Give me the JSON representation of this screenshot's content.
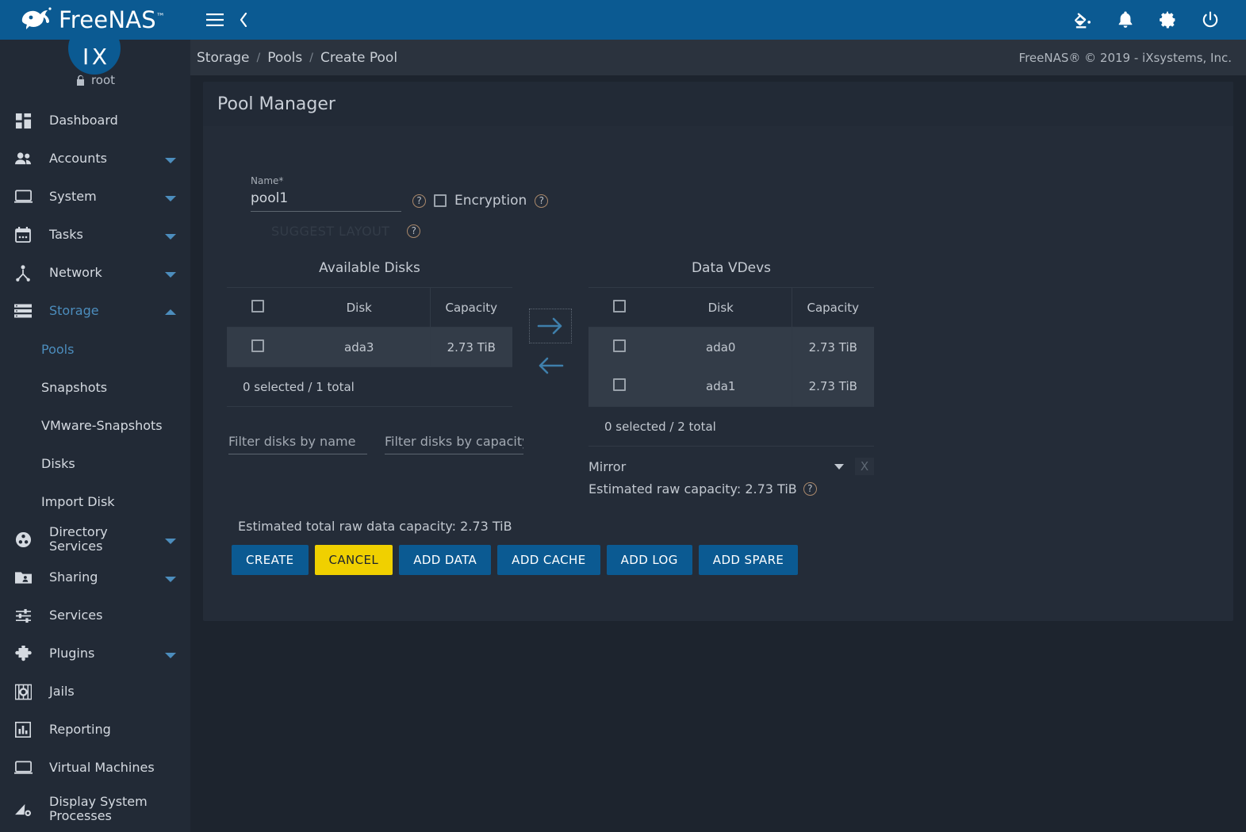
{
  "brand": {
    "name": "FreeNAS",
    "tm": "™",
    "avatar_text": "I X",
    "user": "root"
  },
  "sidebar": {
    "items": [
      {
        "label": "Dashboard",
        "icon": "dashboard-icon",
        "expandable": false,
        "active": false
      },
      {
        "label": "Accounts",
        "icon": "accounts-icon",
        "expandable": true,
        "active": false
      },
      {
        "label": "System",
        "icon": "system-icon",
        "expandable": true,
        "active": false
      },
      {
        "label": "Tasks",
        "icon": "tasks-icon",
        "expandable": true,
        "active": false
      },
      {
        "label": "Network",
        "icon": "network-icon",
        "expandable": true,
        "active": false
      },
      {
        "label": "Storage",
        "icon": "storage-icon",
        "expandable": true,
        "active": true
      }
    ],
    "storage_children": [
      {
        "label": "Pools",
        "active": true
      },
      {
        "label": "Snapshots",
        "active": false
      },
      {
        "label": "VMware-Snapshots",
        "active": false
      },
      {
        "label": "Disks",
        "active": false
      },
      {
        "label": "Import Disk",
        "active": false
      }
    ],
    "items_after": [
      {
        "label": "Directory Services",
        "icon": "directory-services-icon",
        "expandable": true
      },
      {
        "label": "Sharing",
        "icon": "sharing-icon",
        "expandable": true
      },
      {
        "label": "Services",
        "icon": "services-icon",
        "expandable": false
      },
      {
        "label": "Plugins",
        "icon": "plugins-icon",
        "expandable": true
      },
      {
        "label": "Jails",
        "icon": "jails-icon",
        "expandable": false
      },
      {
        "label": "Reporting",
        "icon": "reporting-icon",
        "expandable": false
      },
      {
        "label": "Virtual Machines",
        "icon": "virtual-machines-icon",
        "expandable": false
      },
      {
        "label": "Display System Processes",
        "icon": "display-system-processes-icon",
        "expandable": false
      }
    ]
  },
  "topbar": {
    "menu_icon": "hamburger-menu-icon",
    "back_icon": "chevron-left-icon",
    "right_icons": [
      {
        "name": "theme-icon"
      },
      {
        "name": "notifications-bell-icon"
      },
      {
        "name": "settings-gear-icon"
      },
      {
        "name": "power-icon"
      }
    ]
  },
  "breadcrumb": {
    "items": [
      "Storage",
      "Pools",
      "Create Pool"
    ],
    "separator": "/",
    "copyright": "FreeNAS® © 2019 - iXsystems, Inc."
  },
  "page": {
    "title": "Pool Manager",
    "name_field": {
      "label": "Name",
      "required_mark": "*",
      "value": "pool1"
    },
    "encryption": {
      "label": "Encryption",
      "checked": false
    },
    "suggest_layout_label": "SUGGEST LAYOUT",
    "help_glyph": "?"
  },
  "available_disks": {
    "title": "Available Disks",
    "columns": [
      "Disk",
      "Capacity"
    ],
    "rows": [
      {
        "disk": "ada3",
        "capacity": "2.73 TiB",
        "selected": false
      }
    ],
    "footer": "0 selected / 1 total",
    "filters": [
      {
        "placeholder": "Filter disks by name",
        "value": ""
      },
      {
        "placeholder": "Filter disks by capacity",
        "value": ""
      }
    ]
  },
  "data_vdevs": {
    "title": "Data VDevs",
    "columns": [
      "Disk",
      "Capacity"
    ],
    "rows": [
      {
        "disk": "ada0",
        "capacity": "2.73 TiB",
        "selected": false
      },
      {
        "disk": "ada1",
        "capacity": "2.73 TiB",
        "selected": false
      }
    ],
    "footer": "0 selected / 2 total",
    "vdev_type": "Mirror",
    "remove_label": "X",
    "raw_capacity": "Estimated raw capacity: 2.73 TiB"
  },
  "transfer": {
    "to_right_icon": "arrow-right-icon",
    "to_left_icon": "arrow-left-icon"
  },
  "footer": {
    "total_capacity": "Estimated total raw data capacity: 2.73 TiB",
    "buttons": [
      {
        "label": "CREATE",
        "style": "primary"
      },
      {
        "label": "CANCEL",
        "style": "warn"
      },
      {
        "label": "ADD DATA",
        "style": "primary"
      },
      {
        "label": "ADD CACHE",
        "style": "primary"
      },
      {
        "label": "ADD LOG",
        "style": "primary"
      },
      {
        "label": "ADD SPARE",
        "style": "primary"
      }
    ]
  },
  "colors": {
    "brand_blue": "#0b5a92",
    "accent_link": "#4c8dbd",
    "warn_yellow": "#f0d000",
    "sidebar_bg": "#222a36",
    "page_bg": "#1d242e",
    "card_bg": "#242c38",
    "row_bg": "#333c48"
  }
}
